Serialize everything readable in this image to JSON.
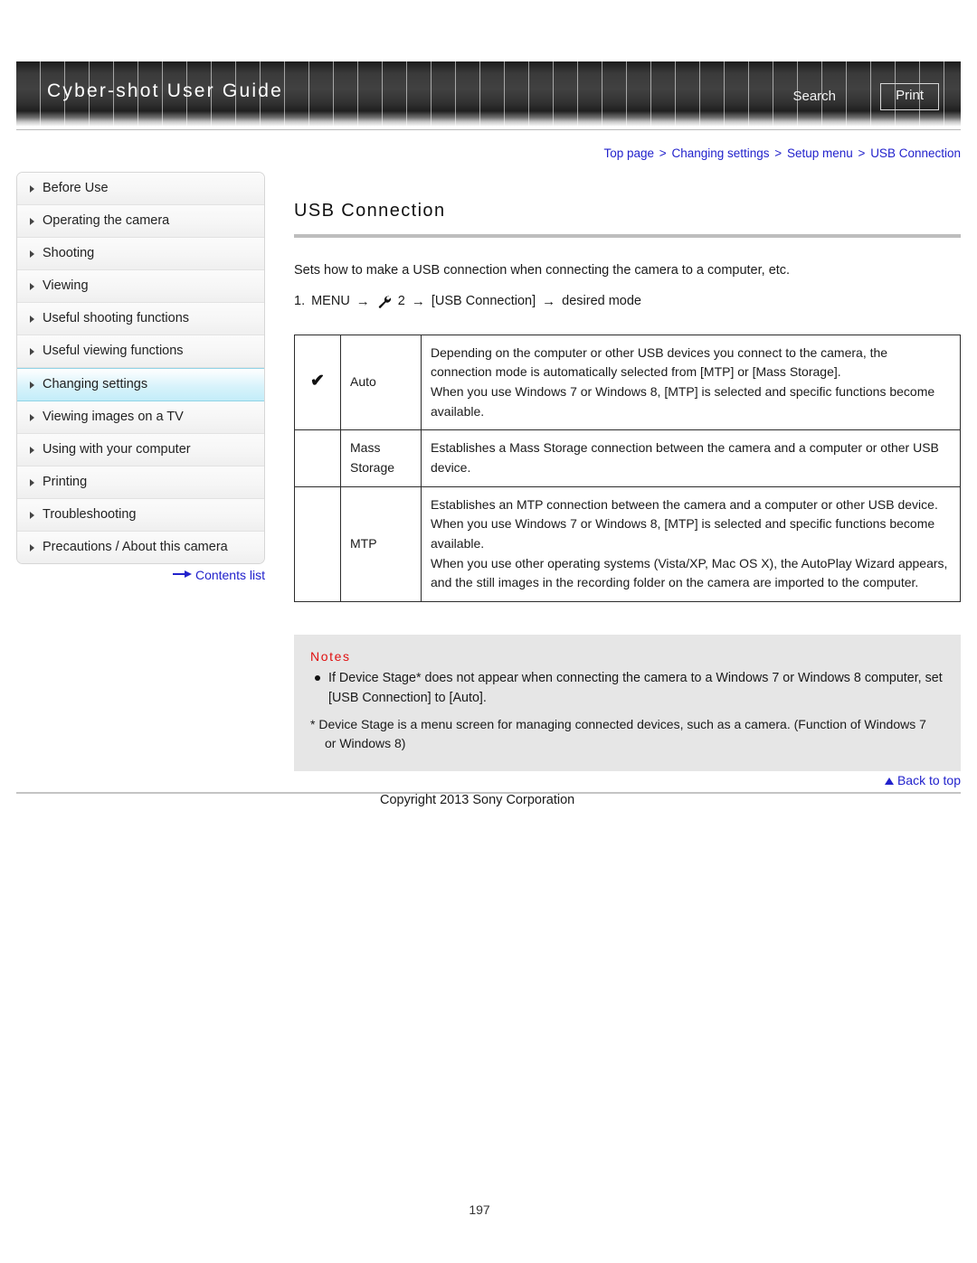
{
  "header": {
    "guide_title": "Cyber-shot User Guide",
    "search_label": "Search",
    "print_label": "Print"
  },
  "breadcrumb": {
    "items": [
      "Top page",
      "Changing settings",
      "Setup menu",
      "USB Connection"
    ],
    "separator": ">"
  },
  "sidebar": {
    "items": [
      {
        "label": "Before Use",
        "active": false
      },
      {
        "label": "Operating the camera",
        "active": false
      },
      {
        "label": "Shooting",
        "active": false
      },
      {
        "label": "Viewing",
        "active": false
      },
      {
        "label": "Useful shooting functions",
        "active": false
      },
      {
        "label": "Useful viewing functions",
        "active": false
      },
      {
        "label": "Changing settings",
        "active": true
      },
      {
        "label": "Viewing images on a TV",
        "active": false
      },
      {
        "label": "Using with your computer",
        "active": false
      },
      {
        "label": "Printing",
        "active": false
      },
      {
        "label": "Troubleshooting",
        "active": false
      },
      {
        "label": "Precautions / About this camera",
        "active": false
      }
    ],
    "contents_link": "Contents list"
  },
  "main": {
    "title": "USB Connection",
    "intro": "Sets how to make a USB connection when connecting the camera to a computer, etc.",
    "step": {
      "number": "1.",
      "menu_label": "MENU",
      "icon": "wrench-icon",
      "icon_number": "2",
      "target": "[USB Connection]",
      "result": "desired mode",
      "arrow": "→"
    },
    "table": {
      "rows": [
        {
          "checked": true,
          "check_glyph": "✔",
          "name": "Auto",
          "description": "Depending on the computer or other USB devices you connect to the camera, the connection mode is automatically selected from [MTP] or [Mass Storage].\nWhen you use Windows 7 or Windows 8, [MTP] is selected and specific functions become available."
        },
        {
          "checked": false,
          "check_glyph": "",
          "name": "Mass Storage",
          "description": "Establishes a Mass Storage connection between the camera and a computer or other USB device."
        },
        {
          "checked": false,
          "check_glyph": "",
          "name": "MTP",
          "description": "Establishes an MTP connection between the camera and a computer or other USB device.\nWhen you use Windows 7 or Windows 8, [MTP] is selected and specific functions become available.\nWhen you use other operating systems (Vista/XP, Mac OS X), the AutoPlay Wizard appears, and the still images in the recording folder on the camera are imported to the computer."
        }
      ]
    },
    "notes": {
      "title": "Notes",
      "bullet": "If Device Stage* does not appear when connecting the camera to a Windows 7 or Windows 8 computer, set [USB Connection] to [Auto].",
      "footnote": "* Device Stage is a menu screen for managing connected devices, such as a camera. (Function of Windows 7",
      "footnote_cont": "or Windows 8)"
    }
  },
  "footer": {
    "back_to_top": "Back to top",
    "copyright": "Copyright 2013 Sony Corporation",
    "page_number": "197"
  },
  "colors": {
    "link_blue": "#2222cc",
    "notes_red": "#e01010",
    "highlight_cyan": "#c3edf9",
    "notes_bg": "#e6e6e6"
  }
}
